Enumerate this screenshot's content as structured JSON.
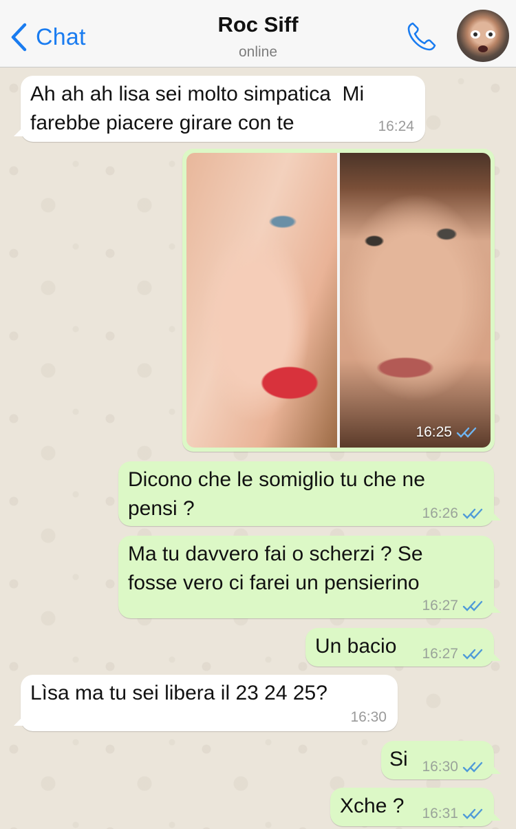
{
  "header": {
    "back_label": "Chat",
    "contact_name": "Roc Siff",
    "status": "online",
    "accent_color": "#1a7cf0"
  },
  "messages": [
    {
      "direction": "incoming",
      "text": "Ah ah ah lisa sei molto simpatica  Mi\nfarebbe piacere girare con te",
      "time": "16:24"
    },
    {
      "direction": "outgoing",
      "type": "image",
      "time": "16:25",
      "read": true
    },
    {
      "direction": "outgoing",
      "text": "Dicono che le somiglio tu che ne\npensi ?",
      "time": "16:26",
      "read": true
    },
    {
      "direction": "outgoing",
      "text": "Ma tu davvero fai o scherzi ? Se\nfosse vero ci farei un pensierino",
      "time": "16:27",
      "read": true
    },
    {
      "direction": "outgoing",
      "text": "Un bacio",
      "time": "16:27",
      "read": true
    },
    {
      "direction": "incoming",
      "text": "Lìsa ma tu sei libera il 23 24 25?",
      "time": "16:30"
    },
    {
      "direction": "outgoing",
      "text": "Si",
      "time": "16:30",
      "read": true
    },
    {
      "direction": "outgoing",
      "text": "Xche ?",
      "time": "16:31",
      "read": true
    }
  ],
  "colors": {
    "incoming_bubble": "#ffffff",
    "outgoing_bubble": "#dcf8c6",
    "read_ticks": "#4f9ad8"
  },
  "icons": [
    "chevron-left-icon",
    "phone-icon",
    "double-check-icon"
  ]
}
